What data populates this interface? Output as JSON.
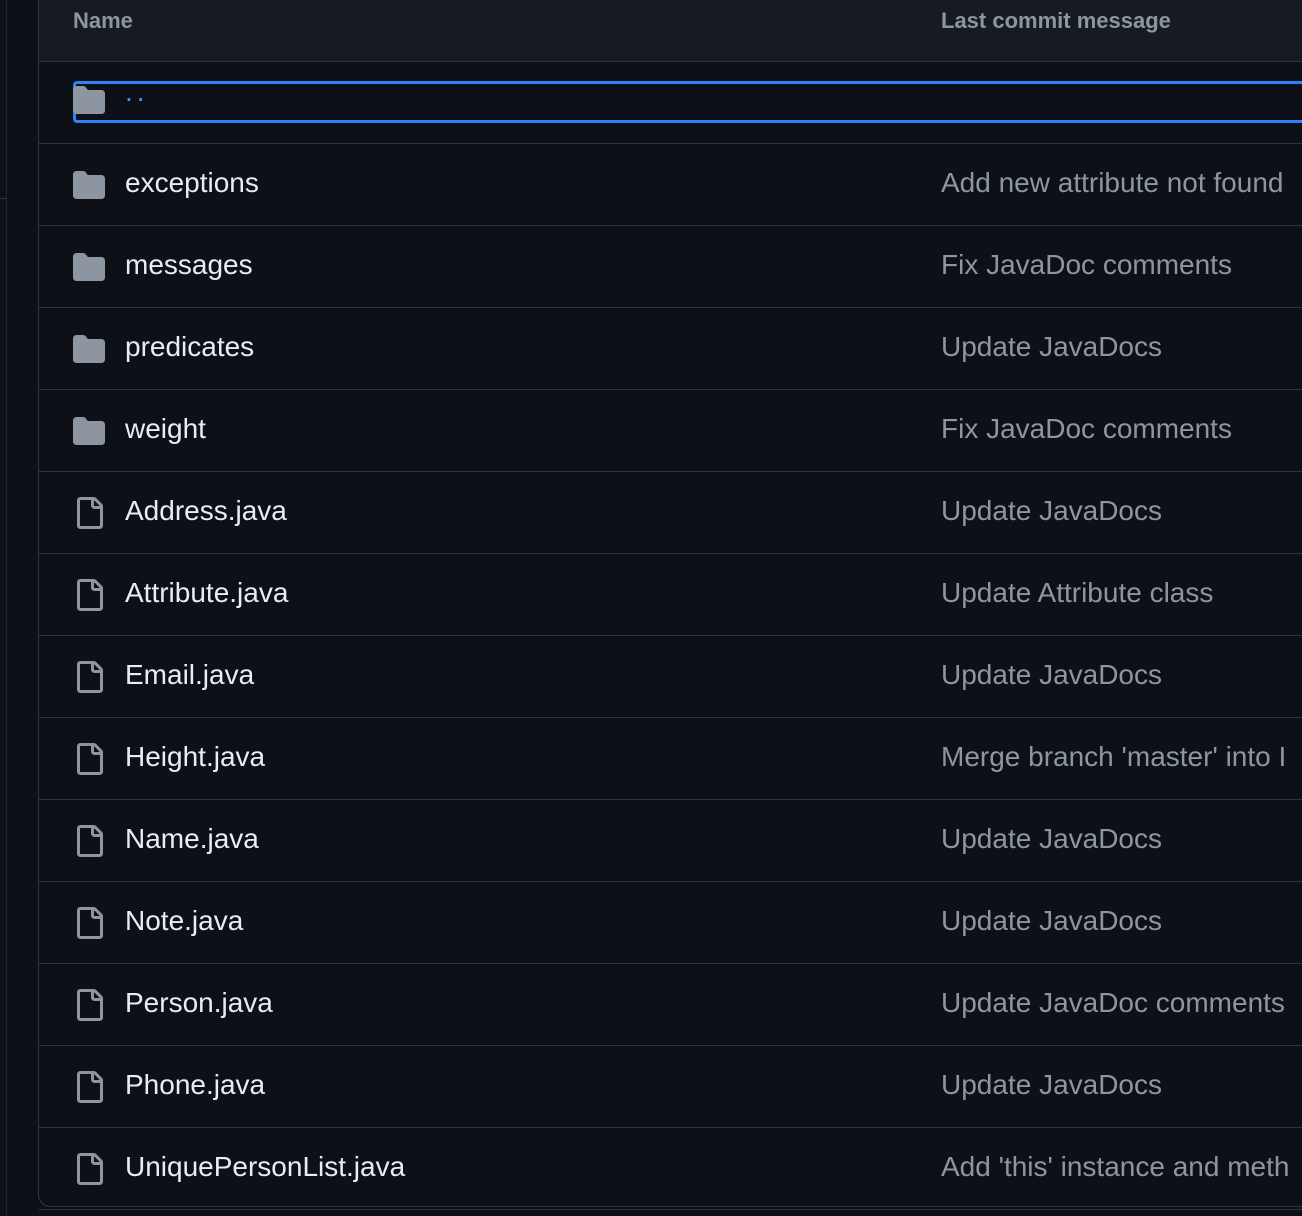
{
  "header": {
    "name_label": "Name",
    "message_label": "Last commit message"
  },
  "parent": {
    "name": "..",
    "icon": "folder-icon"
  },
  "rows": [
    {
      "type": "folder",
      "icon": "folder-icon",
      "name": "exceptions",
      "message": "Add new attribute not found"
    },
    {
      "type": "folder",
      "icon": "folder-icon",
      "name": "messages",
      "message": "Fix JavaDoc comments"
    },
    {
      "type": "folder",
      "icon": "folder-icon",
      "name": "predicates",
      "message": "Update JavaDocs"
    },
    {
      "type": "folder",
      "icon": "folder-icon",
      "name": "weight",
      "message": "Fix JavaDoc comments"
    },
    {
      "type": "file",
      "icon": "file-icon",
      "name": "Address.java",
      "message": "Update JavaDocs"
    },
    {
      "type": "file",
      "icon": "file-icon",
      "name": "Attribute.java",
      "message": "Update Attribute class"
    },
    {
      "type": "file",
      "icon": "file-icon",
      "name": "Email.java",
      "message": "Update JavaDocs"
    },
    {
      "type": "file",
      "icon": "file-icon",
      "name": "Height.java",
      "message": "Merge branch 'master' into I"
    },
    {
      "type": "file",
      "icon": "file-icon",
      "name": "Name.java",
      "message": "Update JavaDocs"
    },
    {
      "type": "file",
      "icon": "file-icon",
      "name": "Note.java",
      "message": "Update JavaDocs"
    },
    {
      "type": "file",
      "icon": "file-icon",
      "name": "Person.java",
      "message": "Update JavaDoc comments"
    },
    {
      "type": "file",
      "icon": "file-icon",
      "name": "Phone.java",
      "message": "Update JavaDocs"
    },
    {
      "type": "file",
      "icon": "file-icon",
      "name": "UniquePersonList.java",
      "message": "Add 'this' instance and meth"
    }
  ],
  "colors": {
    "background": "#0d1117",
    "header_bg": "#161b22",
    "border": "#30363d",
    "text_primary": "#e6edf3",
    "text_muted": "#8d96a0",
    "icon": "#8d96a0",
    "focus": "#2f81f7",
    "link": "#4493f8"
  }
}
